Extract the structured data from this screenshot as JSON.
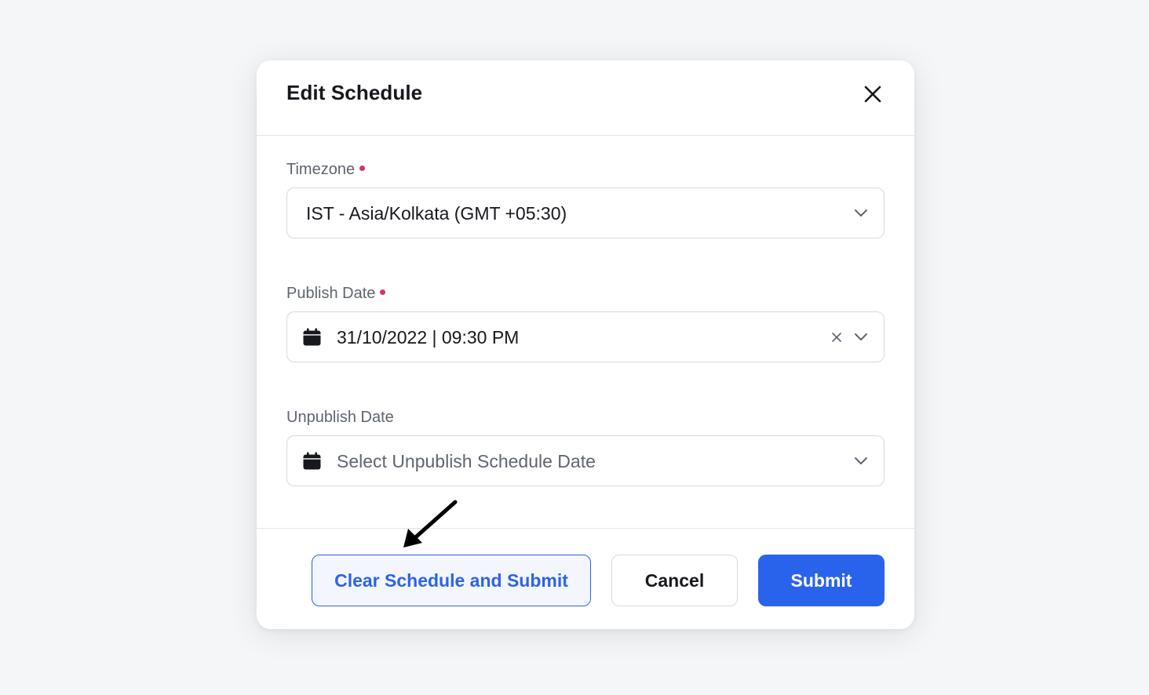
{
  "modal": {
    "title": "Edit Schedule",
    "close_icon": "close-icon"
  },
  "timezone": {
    "label": "Timezone",
    "required": true,
    "value": "IST - Asia/Kolkata (GMT +05:30)"
  },
  "publish_date": {
    "label": "Publish Date",
    "required": true,
    "value": "31/10/2022 | 09:30 PM",
    "icon": "calendar-icon"
  },
  "unpublish_date": {
    "label": "Unpublish Date",
    "required": false,
    "placeholder": "Select Unpublish Schedule Date",
    "icon": "calendar-icon"
  },
  "footer": {
    "clear_submit_label": "Clear Schedule and Submit",
    "cancel_label": "Cancel",
    "submit_label": "Submit"
  },
  "colors": {
    "primary": "#2a63eb",
    "required_dot": "#d6336c",
    "page_background": "#f5f6f8"
  }
}
